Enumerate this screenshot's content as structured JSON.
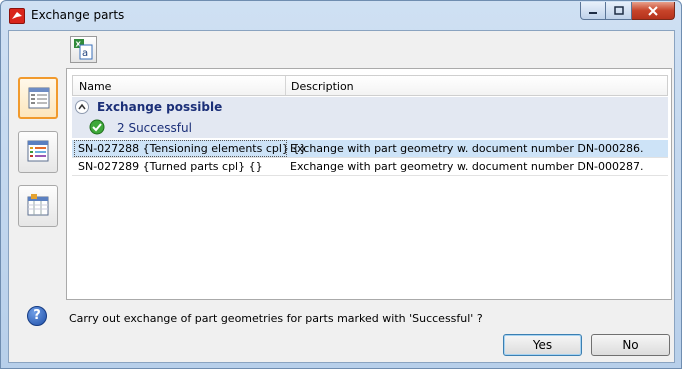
{
  "window": {
    "title": "Exchange parts"
  },
  "toolbar": {
    "export_icon": "excel-export-icon"
  },
  "sidebar": {
    "views": [
      {
        "icon": "list-view-icon",
        "active": true
      },
      {
        "icon": "table-view-icon",
        "active": false
      },
      {
        "icon": "detail-table-icon",
        "active": false
      }
    ]
  },
  "grid": {
    "columns": [
      "Name",
      "Description"
    ],
    "group": {
      "label": "Exchange possible",
      "icon": "collapse-up-icon"
    },
    "subgroup": {
      "label": "2 Successful",
      "icon": "success-check-icon"
    },
    "rows": [
      {
        "name": "SN-027288 {Tensioning elements cpl} {}",
        "description": "Exchange with part geometry w. document number DN-000286.",
        "selected": true
      },
      {
        "name": "SN-027289 {Turned parts cpl} {}",
        "description": "Exchange with part geometry w. document number DN-000287.",
        "selected": false
      }
    ]
  },
  "footer": {
    "question": "Carry out exchange of part geometries for parts marked with  'Successful' ?",
    "yes_label": "Yes",
    "no_label": "No"
  },
  "colors": {
    "group_text": "#1b2f78",
    "group_bg": "#e3e8f2",
    "selection": "#cde3f7",
    "active_view": "#f19a2d"
  }
}
